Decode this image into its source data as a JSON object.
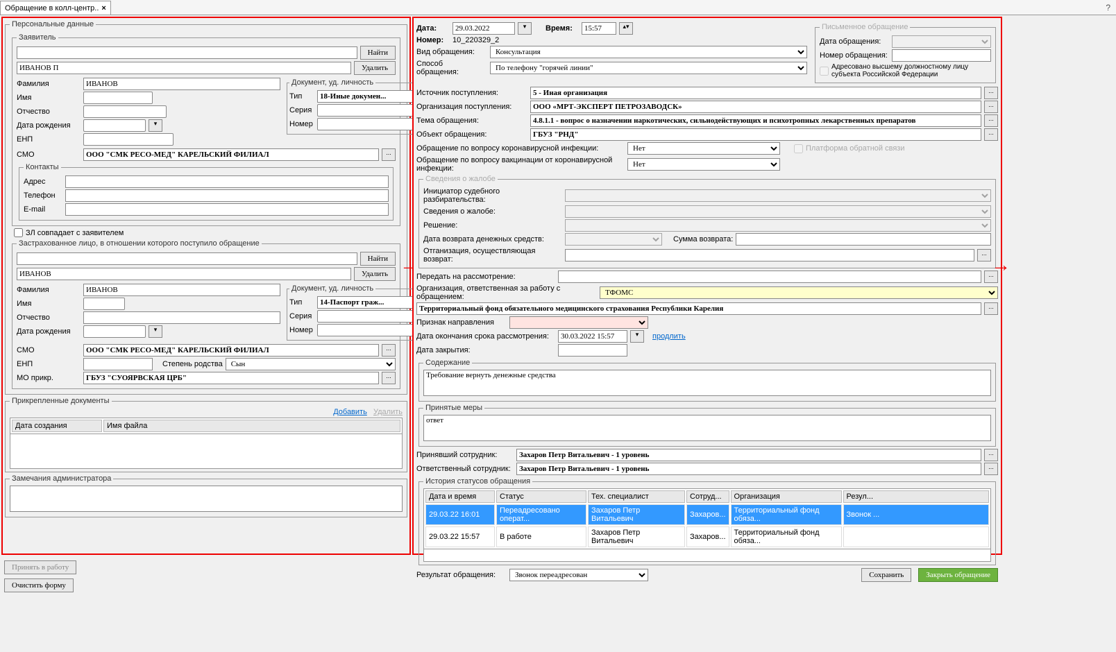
{
  "tab": {
    "title": "Обращение в колл-центр..",
    "close": "×"
  },
  "help_icon": "?",
  "arrows": {
    "mid": "→",
    "right": "→"
  },
  "left": {
    "personal_legend": "Персональные данные",
    "applicant_legend": "Заявитель",
    "find": "Найти",
    "delete": "Удалить",
    "search_result": "ИВАНОВ П",
    "surname_label": "Фамилия",
    "surname": "ИВАНОВ",
    "name_label": "Имя",
    "patronymic_label": "Отчество",
    "dob_label": "Дата рождения",
    "enp_label": "ЕНП",
    "smo_label": "СМО",
    "smo": "ООО \"СМК РЕСО-МЕД\" КАРЕЛЬСКИЙ ФИЛИАЛ",
    "doc_legend": "Документ, уд. личность",
    "doc_type_label": "Тип",
    "doc_type": "18-Иные докумен...",
    "doc_series_label": "Серия",
    "doc_number_label": "Номер",
    "contacts_legend": "Контакты",
    "address_label": "Адрес",
    "phone_label": "Телефон",
    "email_label": "E-mail",
    "zl_match": "ЗЛ совпадает с заявителем",
    "insured_legend": "Застрахованное лицо, в отношении которого поступило обращение",
    "insured_search": "ИВАНОВ",
    "i_surname": "ИВАНОВ",
    "i_doc_type": "14-Паспорт граж...",
    "i_smo": "ООО \"СМК РЕСО-МЕД\" КАРЕЛЬСКИЙ ФИЛИАЛ",
    "relation_label": "Степень родства",
    "relation": "Сын",
    "mo_label": "МО прикр.",
    "mo": "ГБУЗ \"СУОЯРВСКАЯ ЦРБ\"",
    "attach_legend": "Прикрепленные документы",
    "add_link": "Добавить",
    "del_link": "Удалить",
    "col_created": "Дата создания",
    "col_filename": "Имя файла",
    "admin_notes_legend": "Замечания администратора",
    "accept_btn": "Принять в работу",
    "clear_btn": "Очистить форму"
  },
  "right": {
    "date_label": "Дата:",
    "date": "29.03.2022",
    "time_label": "Время:",
    "time": "15:57",
    "number_label": "Номер:",
    "number": "10_220329_2",
    "kind_label": "Вид обращения:",
    "kind": "Консультация",
    "method_label": "Способ обращения:",
    "method": "По телефону \"горячей линии\"",
    "source_label": "Источник поступления:",
    "source": "5 - Иная организация",
    "org_in_label": "Организация поступления:",
    "org_in": "ООО «МРТ-ЭКСПЕРТ ПЕТРОЗАВОДСК»",
    "topic_label": "Тема обращения:",
    "topic": "4.8.1.1 - вопрос о назначении наркотических, сильнодействующих и психотропных лекарственных препаратов",
    "object_label": "Объект обращения:",
    "object": "ГБУЗ \"РНД\"",
    "covid_label": "Обращение по вопросу коронавирусной инфекции:",
    "covid": "Нет",
    "vacc_label": "Обращение по вопросу вакцинации от коронавирусной инфекции:",
    "vacc": "Нет",
    "platform_label": "Платформа обратной связи",
    "complaint_legend": "Сведения о жалобе",
    "initiator_label": "Инициатор судебного разбирательства:",
    "details_label": "Сведения о жалобе:",
    "decision_label": "Решение:",
    "refund_date_label": "Дата возврата денежных средств:",
    "refund_sum_label": "Сумма возврата:",
    "refund_org_label": "Отганизация, осуществляющая возврат:",
    "forward_label": "Передать на рассмотрение:",
    "resp_org_label": "Организация, ответственная за работу с обращением:",
    "resp_org": "ТФОМС",
    "territory": "Территориальный фонд обязательного медицинского страхования Республики Карелия",
    "direction_label": "Признак направления",
    "deadline_label": "Дата окончания срока рассмотрения:",
    "deadline": "30.03.2022 15:57",
    "extend_link": "продлить",
    "close_date_label": "Дата закрытия:",
    "content_legend": "Содержание",
    "content": "Требование вернуть денежные средства",
    "measures_legend": "Принятые меры",
    "measures": "ответ",
    "received_by_label": "Принявший сотрудник:",
    "received_by": "Захаров Петр Витальевич - 1 уровень",
    "responsible_label": "Ответственный сотрудник:",
    "responsible": "Захаров Петр Витальевич - 1 уровень",
    "history_legend": "История статусов обращения",
    "hist_cols": {
      "dt": "Дата и время",
      "status": "Статус",
      "tech": "Тех. специалист",
      "emp": "Сотруд...",
      "org": "Организация",
      "res": "Резул..."
    },
    "hist_rows": [
      {
        "dt": "29.03.22 16:01",
        "status": "Переадресовано операт...",
        "tech": "Захаров Петр Витальевич",
        "emp": "Захаров...",
        "org": "Территориальный фонд обяза...",
        "res": "Звонок ..."
      },
      {
        "dt": "29.03.22 15:57",
        "status": "В работе",
        "tech": "Захаров Петр Витальевич",
        "emp": "Захаров...",
        "org": "Территориальный фонд обяза...",
        "res": ""
      }
    ],
    "result_label": "Результат обращения:",
    "result": "Звонок переадресован",
    "save_btn": "Сохранить",
    "close_btn": "Закрыть обращение",
    "written_legend": "Письменное обращение",
    "written_date_label": "Дата обращения:",
    "written_num_label": "Номер обращения:",
    "addressed_label": "Адресовано высшему должностному лицу субъекта Российской Федерации"
  }
}
